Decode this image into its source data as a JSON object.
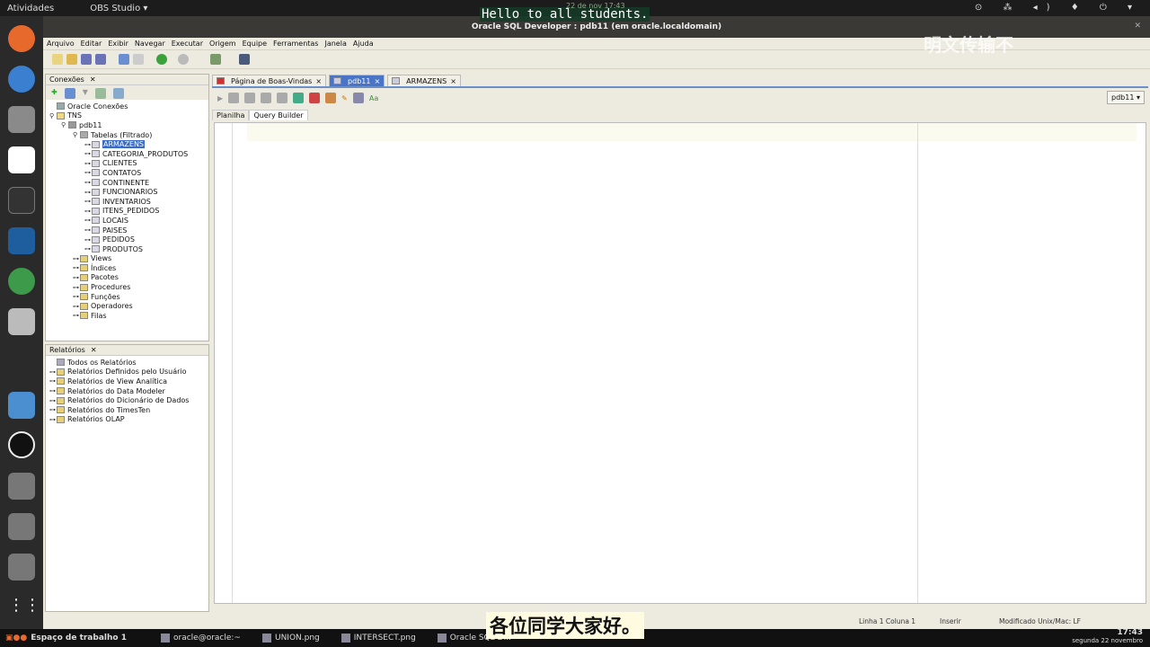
{
  "topbar": {
    "activities": "Atividades",
    "app": "OBS Studio ▾",
    "clock": "22 de nov 17:43"
  },
  "subtitle_en": "Hello to all students.",
  "subtitle_cn": "各位同学大家好。",
  "watermark": "明文传输不",
  "window_title": "Oracle SQL Developer : pdb11 (em oracle.localdomain)",
  "menu": [
    "Arquivo",
    "Editar",
    "Exibir",
    "Navegar",
    "Executar",
    "Origem",
    "Equipe",
    "Ferramentas",
    "Janela",
    "Ajuda"
  ],
  "connections": {
    "title": "Conexões",
    "root": "Oracle Conexões",
    "tns": "TNS",
    "db": "pdb11",
    "tables": "Tabelas (Filtrado)",
    "table_list": [
      "ARMAZENS",
      "CATEGORIA_PRODUTOS",
      "CLIENTES",
      "CONTATOS",
      "CONTINENTE",
      "FUNCIONARIOS",
      "INVENTARIOS",
      "ITENS_PEDIDOS",
      "LOCAIS",
      "PAISES",
      "PEDIDOS",
      "PRODUTOS"
    ],
    "folders": [
      "Views",
      "Índices",
      "Pacotes",
      "Procedures",
      "Funções",
      "Operadores",
      "Filas"
    ]
  },
  "reports": {
    "title": "Relatórios",
    "root": "Todos os Relatórios",
    "items": [
      "Relatórios Definidos pelo Usuário",
      "Relatórios de View Analítica",
      "Relatórios do Data Modeler",
      "Relatórios do Dicionário de Dados",
      "Relatórios do TimesTen",
      "Relatórios OLAP"
    ]
  },
  "doc_tabs": [
    "Página de Boas-Vindas",
    "pdb11",
    "ARMAZENS"
  ],
  "connection_select": "pdb11",
  "sub_tabs": [
    "Planilha",
    "Query Builder"
  ],
  "status": {
    "position": "Linha 1 Coluna 1",
    "mode": "Inserir",
    "modified": "Modificado Unix/Mac: LF"
  },
  "taskbar": {
    "workspace": "Espaço de trabalho 1",
    "items": [
      "oracle@oracle:~",
      "UNION.png",
      "INTERSECT.png",
      "Oracle SQL D..."
    ],
    "time": "17:43",
    "date": "segunda 22 novembro"
  }
}
